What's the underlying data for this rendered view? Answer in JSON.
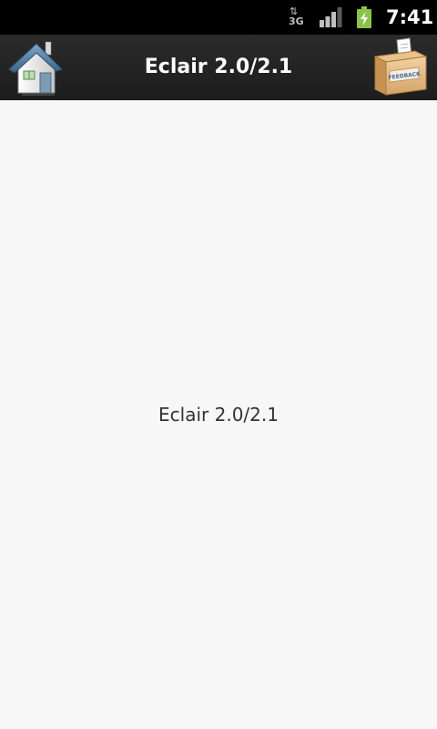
{
  "status_bar": {
    "network_type": "3G",
    "network_arrows": "⇅",
    "time": "7:41",
    "signal_level": 0.75,
    "battery_charging": true,
    "battery_color": "#8bc34a"
  },
  "action_bar": {
    "title": "Eclair 2.0/2.1",
    "home_icon": "house-icon",
    "feedback_icon": "feedback-box-icon",
    "feedback_label": "FEEDBACK"
  },
  "content": {
    "text": "Eclair 2.0/2.1"
  },
  "colors": {
    "status_bar_bg": "#000000",
    "action_bar_bg": "#262626",
    "content_bg": "#f7f7f7",
    "title_text": "#ffffff",
    "body_text": "#333333"
  }
}
